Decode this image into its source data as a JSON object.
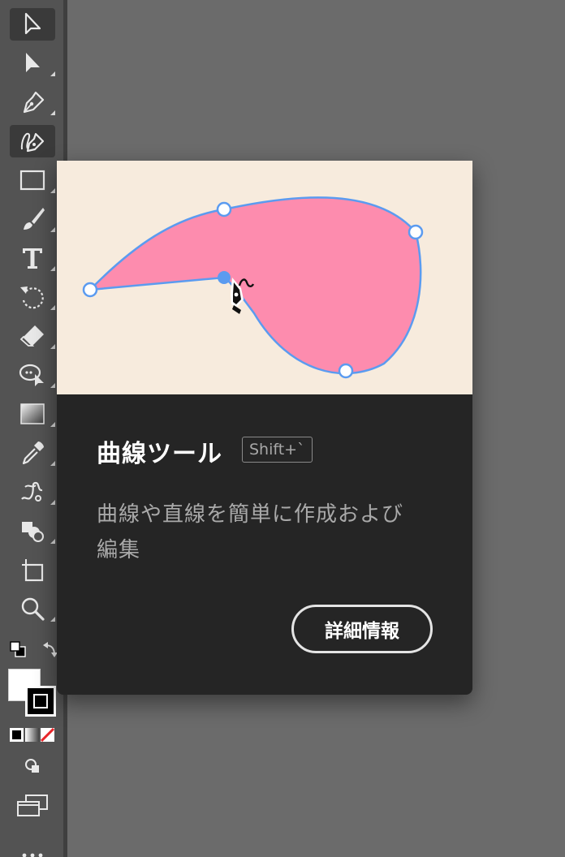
{
  "toolbar": {
    "tools": [
      {
        "icon": "selection-arrow-icon",
        "selected": true
      },
      {
        "icon": "direct-selection-arrow-icon"
      },
      {
        "icon": "pen-tool-icon"
      },
      {
        "icon": "curvature-tool-icon",
        "selected": true
      },
      {
        "icon": "rectangle-tool-icon"
      },
      {
        "icon": "paintbrush-tool-icon"
      },
      {
        "icon": "type-tool-icon"
      },
      {
        "icon": "rotate-tool-icon"
      },
      {
        "icon": "eraser-tool-icon"
      },
      {
        "icon": "puppet-warp-tool-icon"
      },
      {
        "icon": "gradient-tool-icon"
      },
      {
        "icon": "eyedropper-tool-icon"
      },
      {
        "icon": "blend-tool-icon"
      },
      {
        "icon": "shape-builder-tool-icon"
      },
      {
        "icon": "artboard-tool-icon"
      },
      {
        "icon": "zoom-tool-icon"
      }
    ],
    "fill_color": "#ffffff",
    "stroke_color": "#000000"
  },
  "tooltip": {
    "title": "曲線ツール",
    "shortcut": "Shift+`",
    "description_line1": "曲線や直線を簡単に作成および",
    "description_line2": "編集",
    "learn_more_label": "詳細情報",
    "illustration_bg": "#f7ebdd",
    "shape_fill": "#fd8cae",
    "shape_stroke": "#5b9bf0"
  }
}
